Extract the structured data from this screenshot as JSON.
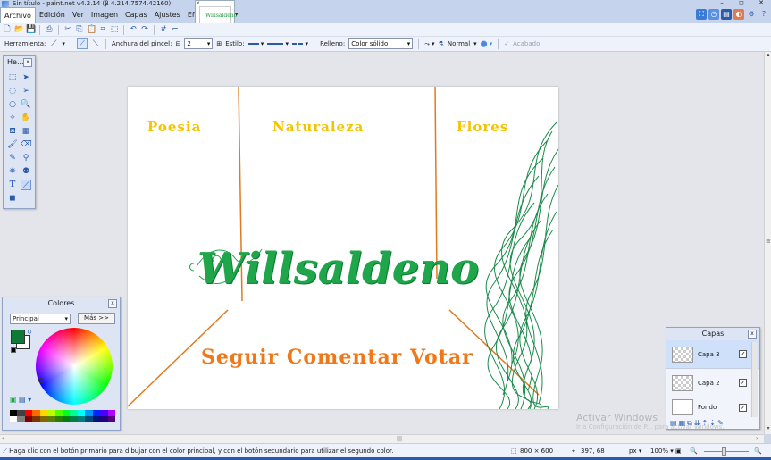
{
  "window": {
    "title": "Sin título - paint.net v4.2.14 (β 4.214.7574.42160)",
    "controls": [
      "–",
      "◻",
      "✕"
    ]
  },
  "menu": [
    "Archivo",
    "Edición",
    "Ver",
    "Imagen",
    "Capas",
    "Ajustes",
    "Efectos"
  ],
  "document_tab": {
    "thumb_text": "Willsaldeno",
    "close": "x"
  },
  "toolbar2": {
    "tools_label": "Herramienta:",
    "brush_width_label": "Anchura del pincel:",
    "brush_width_value": "2",
    "style_label": "Estilo:",
    "fill_label": "Relleno:",
    "fill_value": "Color sólido",
    "blend_value": "Normal",
    "finish_label": "Acabado"
  },
  "tools_panel": {
    "title": "He...",
    "close": "x"
  },
  "colors_panel": {
    "title": "Colores",
    "close": "x",
    "mode_value": "Principal",
    "more_button": "Más >>",
    "primary_color": "#0f7a38",
    "secondary_color": "#ffffff"
  },
  "layers_panel": {
    "title": "Capas",
    "close": "x",
    "layers": [
      {
        "name": "Capa 3",
        "visible": true,
        "active": true
      },
      {
        "name": "Capa 2",
        "visible": true,
        "active": false
      },
      {
        "name": "Fondo",
        "visible": true,
        "active": false
      }
    ]
  },
  "canvas": {
    "nav": [
      "Poesia",
      "Naturaleza",
      "Flores"
    ],
    "brand": "Willsaldeno",
    "actions": "Seguir Comentar Votar",
    "colors": {
      "nav": "#f5c400",
      "brand": "#1fa64a",
      "actions": "#f07818",
      "lines": "#e07a20",
      "hair": "#1a8a4a"
    }
  },
  "watermark": {
    "line1": "Activar Windows",
    "line2": "Ir a Configuración de P... para activar Windows."
  },
  "statusbar": {
    "message": "Haga clic con el botón primario para dibujar con el color principal, y con el botón secundario para utilizar el segundo color.",
    "size": "800 × 600",
    "cursor": "397, 68",
    "unit": "px",
    "zoom": "100%"
  }
}
